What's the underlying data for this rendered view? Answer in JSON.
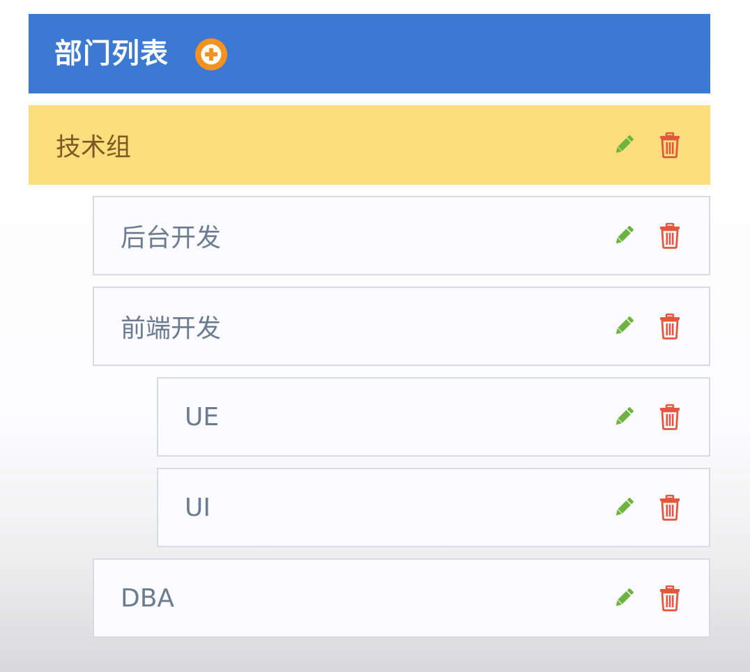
{
  "header": {
    "title": "部门列表",
    "add_icon": "plus-circle-icon",
    "colors": {
      "background": "#3b79d3",
      "add_icon": "#f39220"
    }
  },
  "departments": [
    {
      "name": "技术组",
      "level": 0,
      "selected": true,
      "edit_icon": "pencil-icon",
      "delete_icon": "trash-icon"
    },
    {
      "name": "后台开发",
      "level": 1,
      "selected": false,
      "edit_icon": "pencil-icon",
      "delete_icon": "trash-icon"
    },
    {
      "name": "前端开发",
      "level": 1,
      "selected": false,
      "edit_icon": "pencil-icon",
      "delete_icon": "trash-icon"
    },
    {
      "name": "UE",
      "level": 2,
      "selected": false,
      "edit_icon": "pencil-icon",
      "delete_icon": "trash-icon"
    },
    {
      "name": "UI",
      "level": 2,
      "selected": false,
      "edit_icon": "pencil-icon",
      "delete_icon": "trash-icon"
    },
    {
      "name": "DBA",
      "level": 1,
      "selected": false,
      "edit_icon": "pencil-icon",
      "delete_icon": "trash-icon"
    }
  ],
  "colors": {
    "selected_row": "#fcdf7c",
    "edit_icon": "#6db33f",
    "delete_icon": "#e2573d"
  }
}
